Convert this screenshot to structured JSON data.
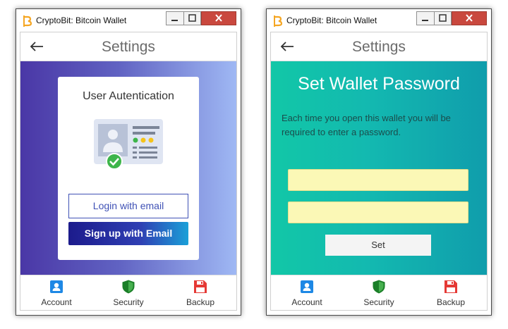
{
  "colors": {
    "accent": "#3f51b5",
    "auth_gradient": [
      "#4a37a6",
      "#9fb8f4"
    ],
    "password_gradient": [
      "#12c7a7",
      "#109dac"
    ],
    "input_bg": "#fbf8b6",
    "close_button": "#c9483e",
    "account_icon": "#1e88e5",
    "security_icon": "#1b7f28",
    "backup_icon": "#e53935",
    "app_icon": "#f5a623"
  },
  "windows": [
    {
      "title": "CryptoBit: Bitcoin Wallet",
      "screen_title": "Settings",
      "auth_card": {
        "title": "User Autentication",
        "illustration": "id-card-verified-icon",
        "login_label": "Login with email",
        "signup_label": "Sign up with Email"
      },
      "nav": [
        {
          "label": "Account",
          "icon": "account-icon"
        },
        {
          "label": "Security",
          "icon": "shield-icon"
        },
        {
          "label": "Backup",
          "icon": "save-icon"
        }
      ]
    },
    {
      "title": "CryptoBit: Bitcoin Wallet",
      "screen_title": "Settings",
      "password": {
        "title": "Set Wallet Password",
        "description": "Each time you open this wallet you will be required to enter a password.",
        "password_value": "",
        "confirm_value": "",
        "set_label": "Set"
      },
      "nav": [
        {
          "label": "Account",
          "icon": "account-icon"
        },
        {
          "label": "Security",
          "icon": "shield-icon"
        },
        {
          "label": "Backup",
          "icon": "save-icon"
        }
      ]
    }
  ]
}
